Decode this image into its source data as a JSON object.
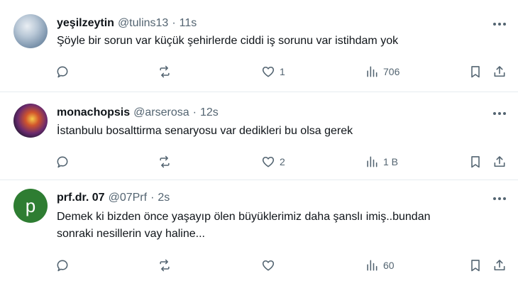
{
  "tweets": [
    {
      "name": "yeşilzeytin",
      "handle": "@tulins13",
      "separator": "·",
      "time": "11s",
      "text": "Şöyle bir sorun var küçük şehirlerde ciddi iş sorunu var istihdam yok",
      "likes": "1",
      "views": "706"
    },
    {
      "name": "monachopsis",
      "handle": "@arserosa",
      "separator": "·",
      "time": "12s",
      "text": "İstanbulu bosalttirma senaryosu var dedikleri bu olsa gerek",
      "likes": "2",
      "views": "1 B"
    },
    {
      "name": "prf.dr. 07",
      "handle": "@07Prf",
      "separator": "·",
      "time": "2s",
      "avatar_letter": "p",
      "text_line1": "Demek ki bizden önce yaşayıp ölen büyüklerimiz daha şanslı imiş..bundan",
      "text_line2": "sonraki nesillerin vay haline...",
      "likes": "",
      "views": "60"
    }
  ],
  "icons": {
    "reply": "reply-icon",
    "retweet": "retweet-icon",
    "like": "heart-icon",
    "views": "views-chart-icon",
    "bookmark": "bookmark-icon",
    "share": "share-icon",
    "more": "more-icon"
  },
  "colors": {
    "text": "#0f1419",
    "muted": "#536471",
    "divider": "#e6ecf0",
    "avatar_p": "#2e7d32"
  }
}
